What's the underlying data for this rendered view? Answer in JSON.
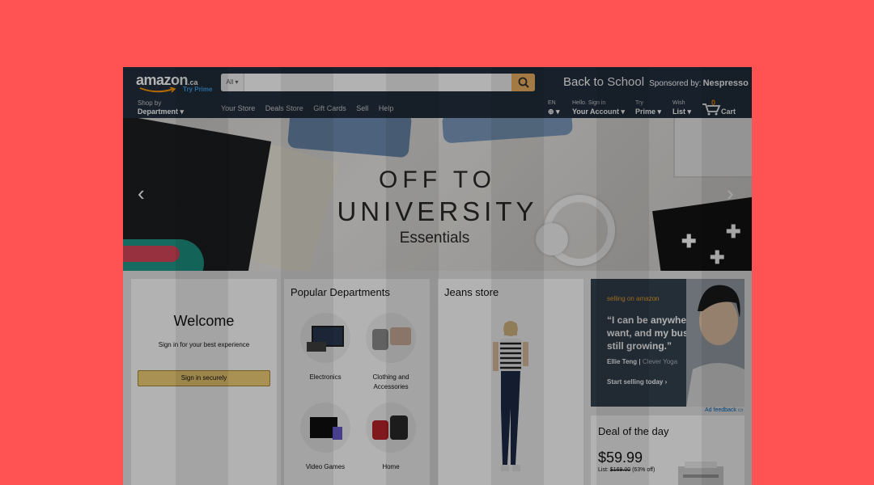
{
  "header": {
    "logo": {
      "word": "amazon",
      "tld": ".ca",
      "try_prime": "Try Prime"
    },
    "search": {
      "category": "All",
      "placeholder": ""
    },
    "promo": {
      "title": "Back to School",
      "sponsored": "Sponsored by:",
      "brand": "Nespresso"
    },
    "shop_by": {
      "line1": "Shop by",
      "line2": "Department"
    },
    "nav_links": [
      "Your Store",
      "Deals Store",
      "Gift Cards",
      "Sell",
      "Help"
    ],
    "lang": {
      "line1": "EN",
      "line2": ""
    },
    "account": {
      "line1": "Hello. Sign in",
      "line2": "Your Account"
    },
    "prime": {
      "line1": "Try",
      "line2": "Prime"
    },
    "wishlist": {
      "line1": "Wish",
      "line2": "List"
    },
    "cart": {
      "count": "0",
      "label": "Cart"
    }
  },
  "hero": {
    "line1": "OFF TO",
    "line2": "UNIVERSITY",
    "line3": "Essentials",
    "prev_icon": "chevron-left-icon",
    "next_icon": "chevron-right-icon"
  },
  "welcome": {
    "title": "Welcome",
    "subtitle": "Sign in for your best experience",
    "button": "Sign in securely"
  },
  "popular": {
    "title": "Popular Departments",
    "items": [
      {
        "label": "Electronics"
      },
      {
        "label": "Clothing and Accessories"
      },
      {
        "label": "Video Games"
      },
      {
        "label": "Home"
      }
    ]
  },
  "jeans": {
    "title": "Jeans store"
  },
  "ad": {
    "brand": "selling on amazon",
    "quote": "“I can be anywhere I want, and my business is still growing.”",
    "name": "Ellie Teng",
    "company": "Clever Yoga",
    "cta": "Start selling today ›",
    "feedback": "Ad feedback"
  },
  "deal": {
    "title": "Deal of the day",
    "price": "$59.99",
    "list_label": "List:",
    "list_price": "$169.00",
    "off": "(63% off)"
  },
  "colors": {
    "background": "#ff5252",
    "header": "#232f3e",
    "search_button": "#febd69",
    "button": "#f3d078"
  }
}
